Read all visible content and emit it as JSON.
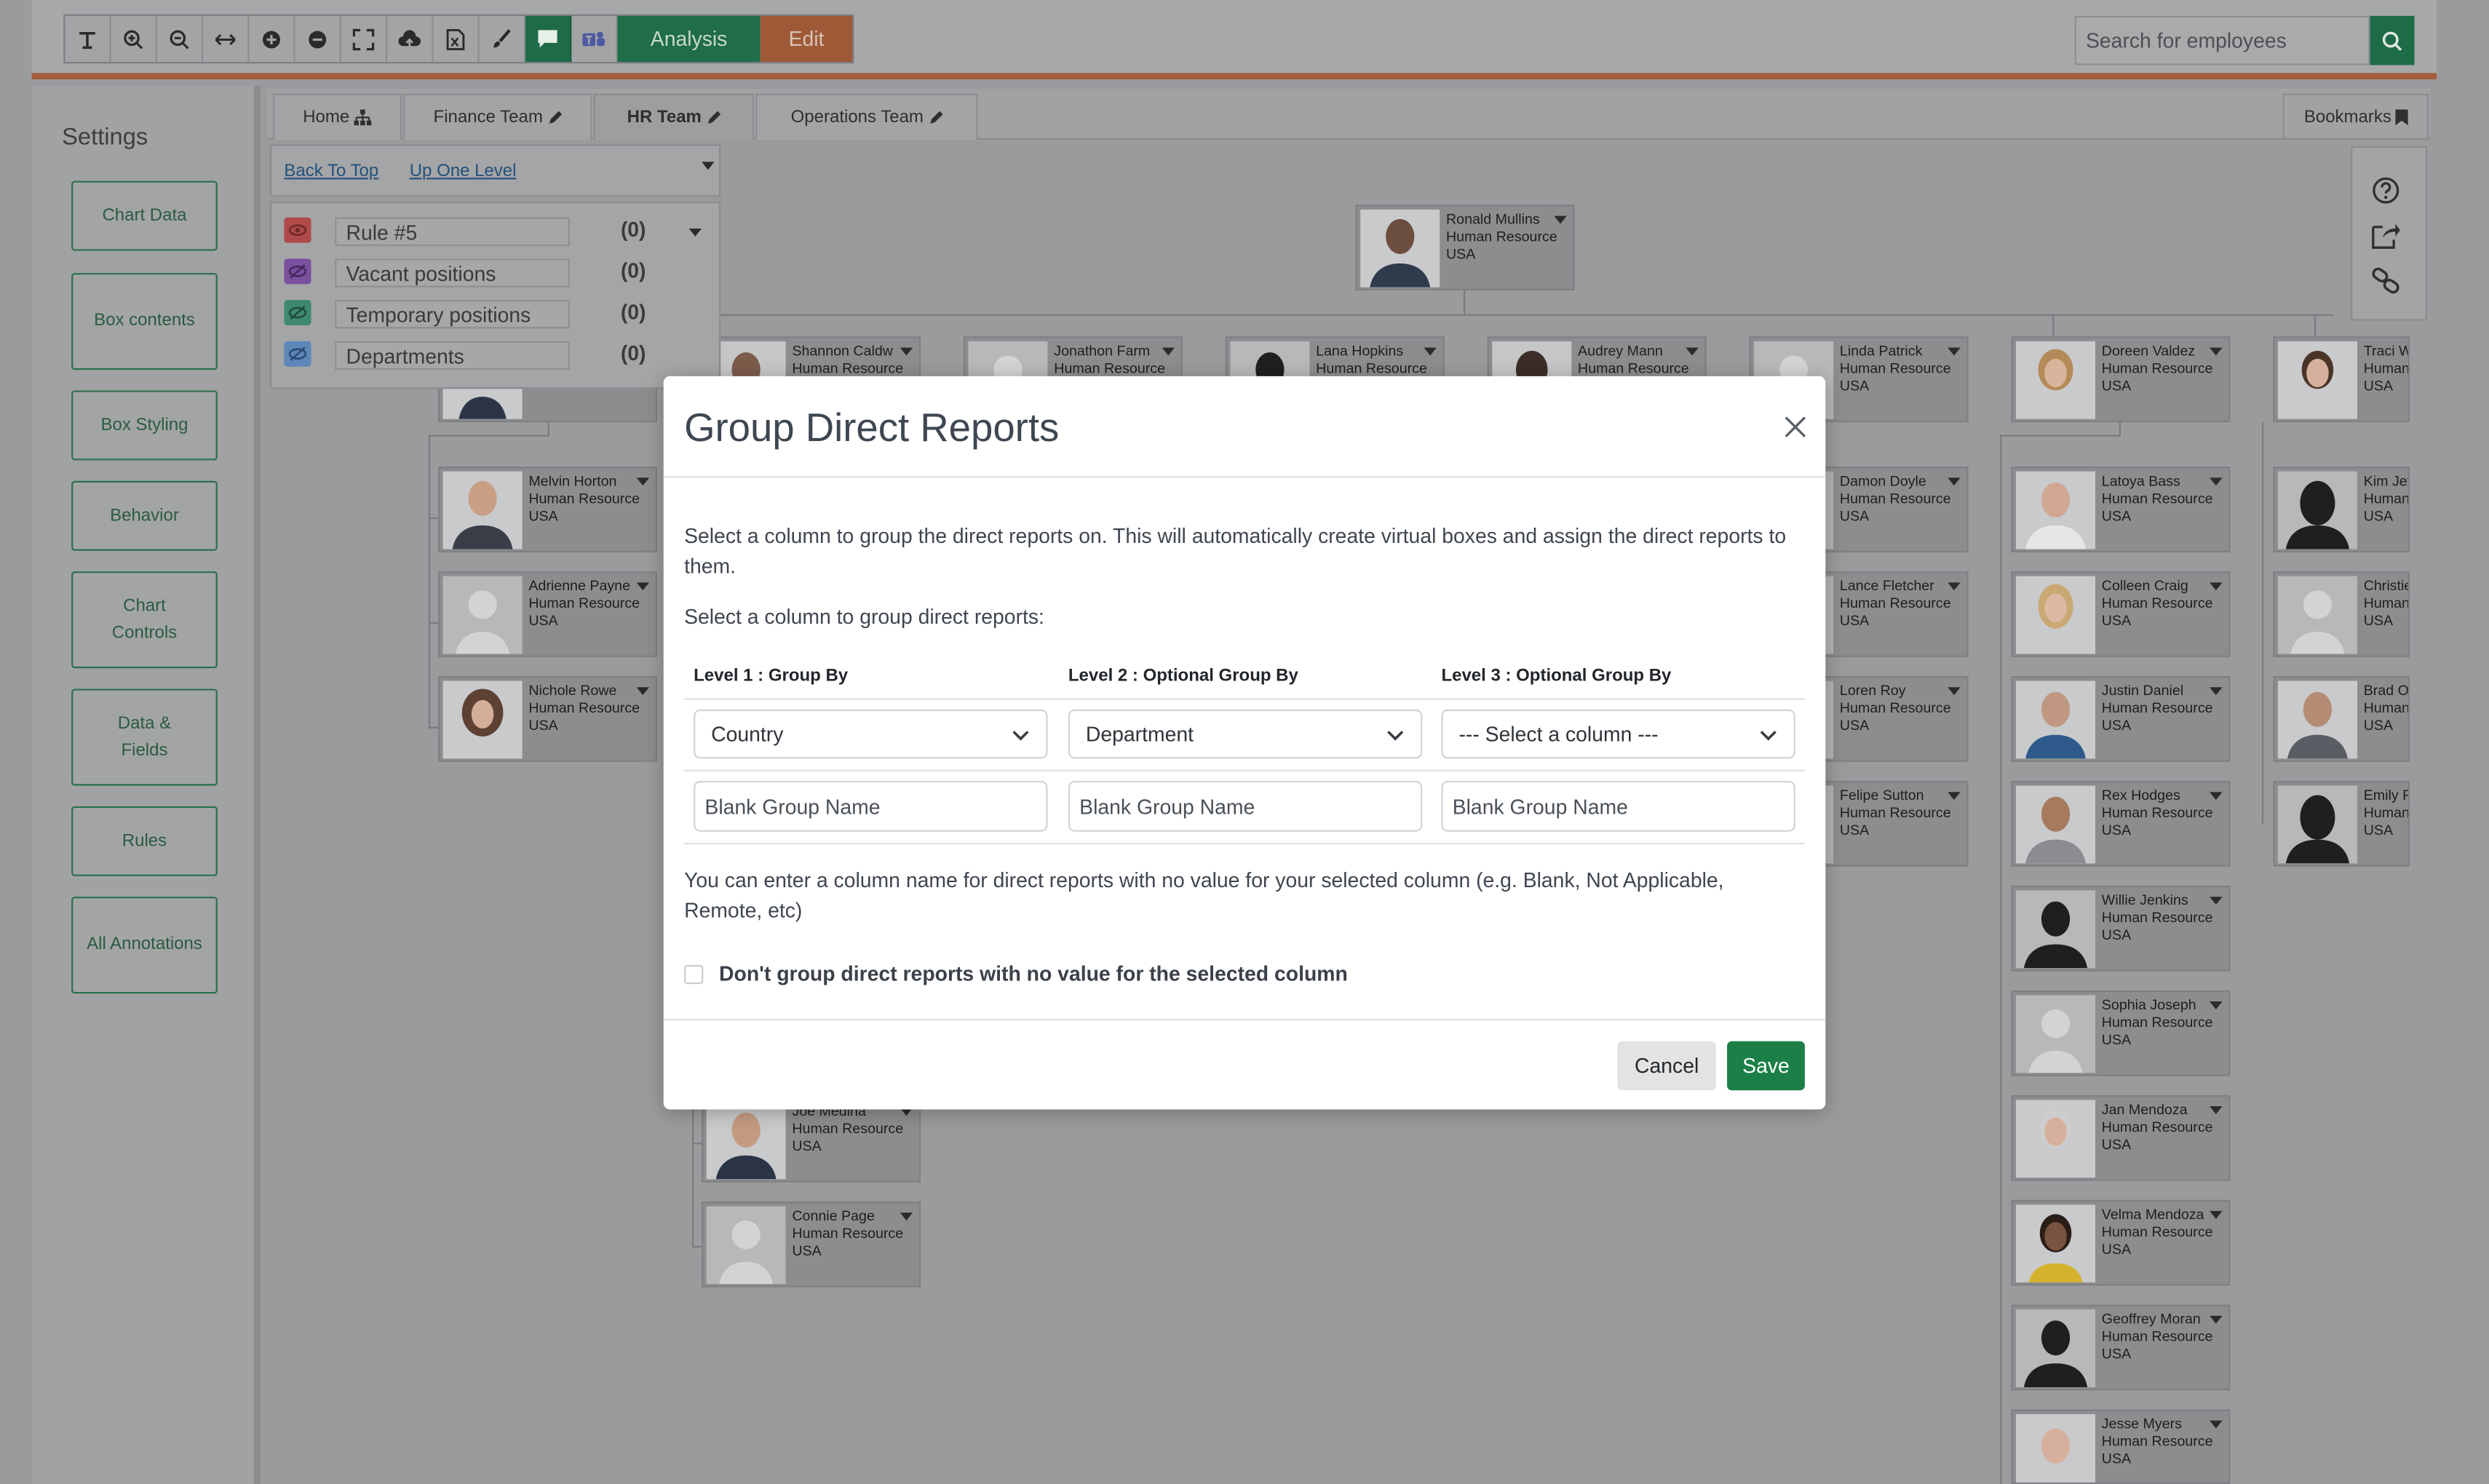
{
  "toolbar": {
    "tools": [
      "text-tool-icon",
      "zoom-in-icon",
      "zoom-out-icon",
      "fit-width-icon",
      "expand-all-icon",
      "collapse-all-icon",
      "fullscreen-icon",
      "cloud-upload-icon",
      "excel-export-icon",
      "paint-brush-icon",
      "comment-icon",
      "teams-icon"
    ],
    "analysis_label": "Analysis",
    "edit_label": "Edit"
  },
  "search": {
    "placeholder": "Search for employees"
  },
  "sidebar": {
    "title": "Settings",
    "buttons": [
      "Chart Data",
      "Box contents",
      "Box Styling",
      "Behavior",
      "Chart Controls",
      "Data & Fields",
      "Rules",
      "All Annotations"
    ]
  },
  "tabs": [
    {
      "label": "Home"
    },
    {
      "label": "Finance Team"
    },
    {
      "label": "HR Team"
    },
    {
      "label": "Operations Team"
    }
  ],
  "bookmarks_label": "Bookmarks",
  "breadcrumb": {
    "back_to_top": "Back To Top",
    "up_one_level": "Up One Level"
  },
  "legend": {
    "rules": [
      {
        "name": "Rule #5",
        "count": "(0)",
        "color": "#b04a4a"
      },
      {
        "name": "Vacant positions",
        "count": "(0)",
        "color": "#7a4f9e"
      },
      {
        "name": "Temporary positions",
        "count": "(0)",
        "color": "#3f8a6f"
      },
      {
        "name": "Departments",
        "count": "(0)",
        "color": "#5d86b9"
      }
    ]
  },
  "employees": [
    {
      "name": "Ronald Mullins",
      "dept": "Human Resources",
      "country": "USA"
    },
    {
      "name": "Shannon Caldw",
      "dept": "Human Resources",
      "country": ""
    },
    {
      "name": "Jonathon Farm",
      "dept": "Human Resources",
      "country": ""
    },
    {
      "name": "Lana Hopkins",
      "dept": "Human Resources",
      "country": ""
    },
    {
      "name": "Audrey Mann",
      "dept": "Human Resources",
      "country": ""
    },
    {
      "name": "Linda Patrick",
      "dept": "Human Resources",
      "country": "USA"
    },
    {
      "name": "Doreen Valdez",
      "dept": "Human Resources",
      "country": "USA"
    },
    {
      "name": "Traci W",
      "dept": "Human",
      "country": "USA"
    },
    {
      "name": "Melvin Horton",
      "dept": "Human Resources",
      "country": "USA"
    },
    {
      "name": "Adrienne Payne",
      "dept": "Human Resources",
      "country": "USA"
    },
    {
      "name": "Nichole Rowe",
      "dept": "Human Resources",
      "country": "USA"
    },
    {
      "name": "Damon Doyle",
      "dept": "Human Resources",
      "country": "USA"
    },
    {
      "name": "Lance Fletcher",
      "dept": "Human Resources",
      "country": "USA"
    },
    {
      "name": "Loren Roy",
      "dept": "Human Resources",
      "country": "USA"
    },
    {
      "name": "Felipe Sutton",
      "dept": "Human Resources",
      "country": "USA"
    },
    {
      "name": "Latoya Bass",
      "dept": "Human Resources",
      "country": "USA"
    },
    {
      "name": "Colleen Craig",
      "dept": "Human Resources",
      "country": "USA"
    },
    {
      "name": "Justin Daniel",
      "dept": "Human Resources",
      "country": "USA"
    },
    {
      "name": "Rex Hodges",
      "dept": "Human Resources",
      "country": "USA"
    },
    {
      "name": "Willie Jenkins",
      "dept": "Human Resources",
      "country": "USA"
    },
    {
      "name": "Sophia Joseph",
      "dept": "Human Resources",
      "country": "USA"
    },
    {
      "name": "Jan Mendoza",
      "dept": "Human Resources",
      "country": "USA"
    },
    {
      "name": "Velma Mendoza",
      "dept": "Human Resources",
      "country": "USA"
    },
    {
      "name": "Geoffrey Moran",
      "dept": "Human Resources",
      "country": "USA"
    },
    {
      "name": "Jesse Myers",
      "dept": "Human Resources",
      "country": "USA"
    },
    {
      "name": "Kim Jef",
      "dept": "Human",
      "country": "USA"
    },
    {
      "name": "Christie",
      "dept": "Human",
      "country": "USA"
    },
    {
      "name": "Brad O",
      "dept": "Human",
      "country": "USA"
    },
    {
      "name": "Emily F",
      "dept": "Human",
      "country": "USA"
    },
    {
      "name": "Joe Medina",
      "dept": "Human Resources",
      "country": "USA"
    },
    {
      "name": "Connie Page",
      "dept": "Human Resources",
      "country": "USA"
    }
  ],
  "modal": {
    "title": "Group Direct Reports",
    "description": "Select a column to group the direct reports on. This will automatically create virtual boxes and assign the direct reports to them.",
    "select_prompt": "Select a column to group direct reports:",
    "columns": [
      {
        "header": "Level 1 : Group By",
        "value": "Country",
        "blank_placeholder": "Blank Group Name"
      },
      {
        "header": "Level 2 : Optional Group By",
        "value": "Department",
        "blank_placeholder": "Blank Group Name"
      },
      {
        "header": "Level 3 : Optional Group By",
        "value": "--- Select a column ---",
        "blank_placeholder": "Blank Group Name"
      }
    ],
    "blank_note": "You can enter a column name for direct reports with no value for your selected column (e.g. Blank, Not Applicable, Remote, etc)",
    "no_value_label": "Don't group direct reports with no value for the selected column",
    "cancel_label": "Cancel",
    "save_label": "Save"
  }
}
